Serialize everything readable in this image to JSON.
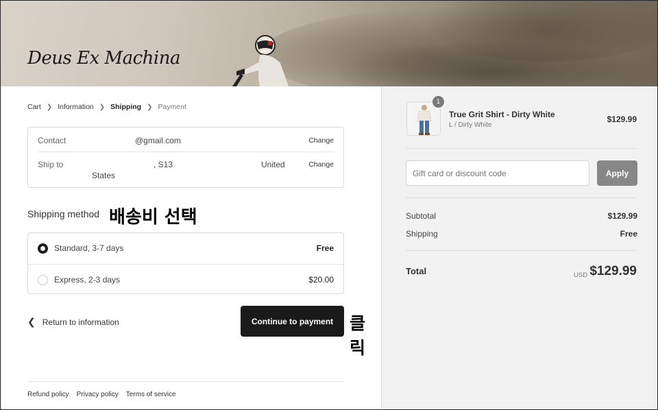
{
  "header": {
    "logo_text": "Deus Ex Machina"
  },
  "breadcrumb": {
    "items": [
      "Cart",
      "Information",
      "Shipping",
      "Payment"
    ]
  },
  "info": {
    "contact_label": "Contact",
    "contact_value": "@gmail.com",
    "ship_to_label": "Ship to",
    "ship_to_part1": ", S13",
    "ship_to_part2": "United",
    "ship_to_part3": "States",
    "change_label": "Change"
  },
  "shipping": {
    "title": "Shipping method",
    "annotation": "배송비 선택",
    "methods": [
      {
        "label": "Standard, 3-7 days",
        "price": "Free",
        "selected": true
      },
      {
        "label": "Express, 2-3 days",
        "price": "$20.00",
        "selected": false
      }
    ]
  },
  "actions": {
    "return_label": "Return to information",
    "continue_label": "Continue to payment",
    "continue_annotation": "클릭"
  },
  "footer": {
    "links": [
      "Refund policy",
      "Privacy policy",
      "Terms of service"
    ]
  },
  "summary": {
    "product": {
      "name": "True Grit Shirt - Dirty White",
      "variant": "L / Dirty White",
      "price": "$129.99",
      "quantity": "1"
    },
    "discount_placeholder": "Gift card or discount code",
    "apply_label": "Apply",
    "subtotal_label": "Subtotal",
    "subtotal_value": "$129.99",
    "shipping_label": "Shipping",
    "shipping_value": "Free",
    "total_label": "Total",
    "currency": "USD",
    "total_value": "$129.99"
  },
  "colors": {
    "primary_button": "#1a1a1a",
    "apply_button": "#878787",
    "sidebar_bg": "#f2f2f2"
  }
}
